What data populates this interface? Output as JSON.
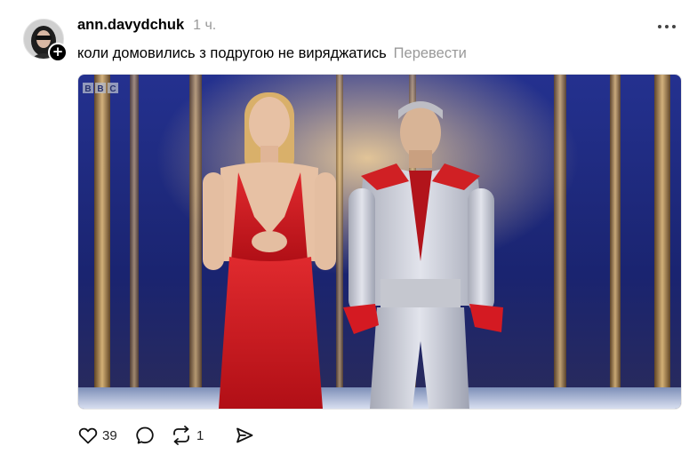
{
  "post": {
    "username": "ann.davydchuk",
    "time": "1 ч.",
    "caption": "коли домовились з подругою не виряджатись",
    "translate_label": "Перевести",
    "media": {
      "watermark": "BBC",
      "description_icon": "video-frame"
    },
    "follow_icon": "plus-icon",
    "more_icon": "more-horizontal-icon"
  },
  "actions": {
    "likes": "39",
    "comments": "",
    "reposts": "1",
    "share": ""
  },
  "colors": {
    "text": "#000000",
    "muted": "#999999",
    "dress_red": "#c8141c",
    "suit_silver": "#c7c9d2",
    "stage_blue": "#1a2a86",
    "stage_gold": "#d6a24a"
  }
}
